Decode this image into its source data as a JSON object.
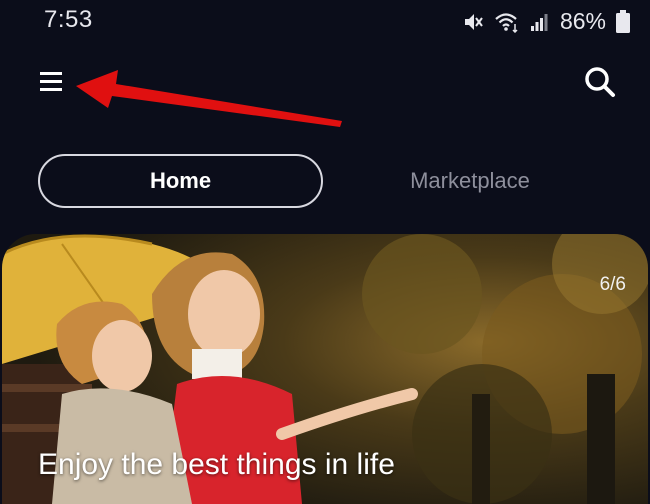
{
  "status_bar": {
    "time": "7:53",
    "battery": "86%",
    "icons": [
      "mute-icon",
      "wifi-icon",
      "signal-icon",
      "battery-icon"
    ]
  },
  "header": {
    "menu_icon": "hamburger-menu-icon",
    "search_icon": "search-icon",
    "annotation_color": "#e01010"
  },
  "tabs": [
    {
      "label": "Home",
      "active": true
    },
    {
      "label": "Marketplace",
      "active": false
    }
  ],
  "banner": {
    "slide_counter": "6/6",
    "caption": "Enjoy the best things in life"
  },
  "colors": {
    "background": "#0b0d1a",
    "inactive_tab": "#8e8f9c",
    "annotation": "#e01010"
  }
}
